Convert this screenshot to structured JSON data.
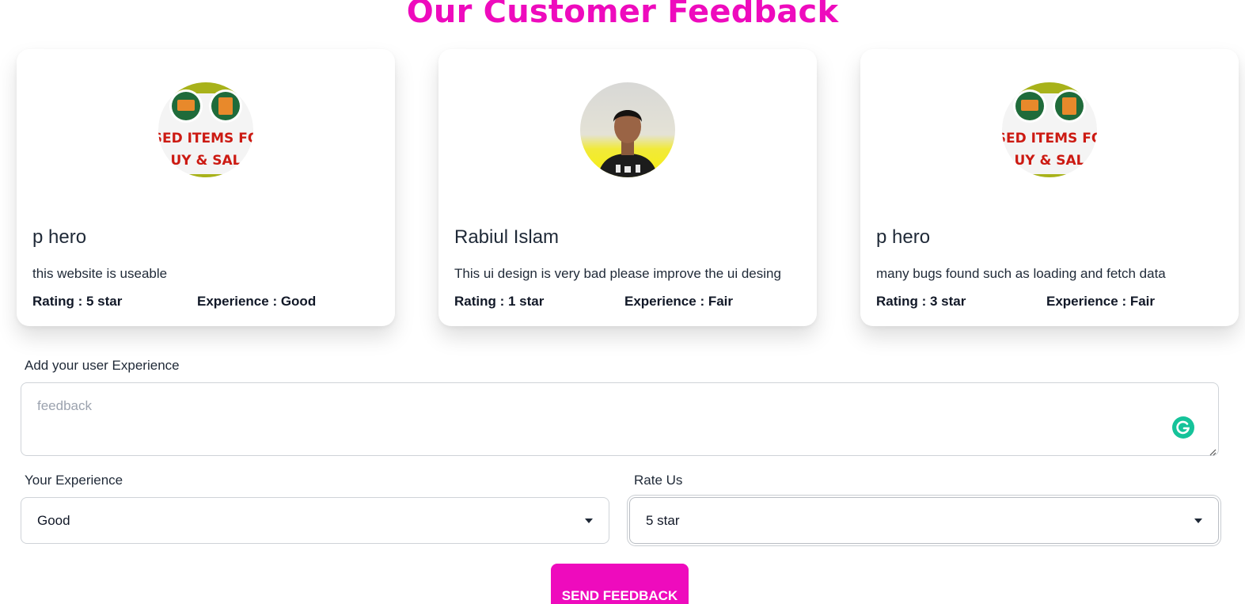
{
  "header": {
    "title": "Our Customer Feedback"
  },
  "reviews": [
    {
      "name": "p hero",
      "comment": "this website is useable",
      "rating": "Rating : 5 star",
      "experience": "Experience : Good",
      "avatar": "used-items-logo",
      "logo_text": [
        "SED ITEMS FO",
        "UY & SAL"
      ]
    },
    {
      "name": "Rabiul Islam",
      "comment": "This ui design is very bad please improve the ui desing",
      "rating": "Rating : 1 star",
      "experience": "Experience : Fair",
      "avatar": "user-photo"
    },
    {
      "name": "p hero",
      "comment": "many bugs found such as loading and fetch data",
      "rating": "Rating : 3 star",
      "experience": "Experience : Fair",
      "avatar": "used-items-logo",
      "logo_text": [
        "SED ITEMS FO",
        "UY & SAL"
      ]
    }
  ],
  "form": {
    "feedback_label": "Add your user Experience",
    "feedback_placeholder": "feedback",
    "experience_label": "Your Experience",
    "experience_value": "Good",
    "rating_label": "Rate Us",
    "rating_value": "5 star",
    "submit_label": "SEND FEEDBACK"
  },
  "colors": {
    "accent": "#ee0bbd",
    "grammarly": "#15c39a"
  }
}
